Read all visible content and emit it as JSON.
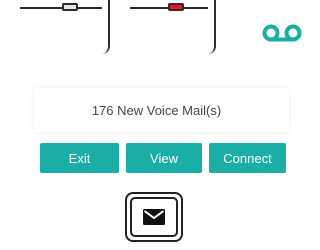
{
  "notification": {
    "message": "176 New Voice Mail(s)"
  },
  "actions": {
    "exit_label": "Exit",
    "view_label": "View",
    "connect_label": "Connect"
  },
  "icons": {
    "voicemail": "voicemail-icon",
    "message_key": "envelope-icon"
  },
  "colors": {
    "button": "#1aaea6",
    "voicemail_icon": "#1aaea6",
    "indicator_red": "#e8142a",
    "indicator_gray": "#e6e6e6"
  }
}
